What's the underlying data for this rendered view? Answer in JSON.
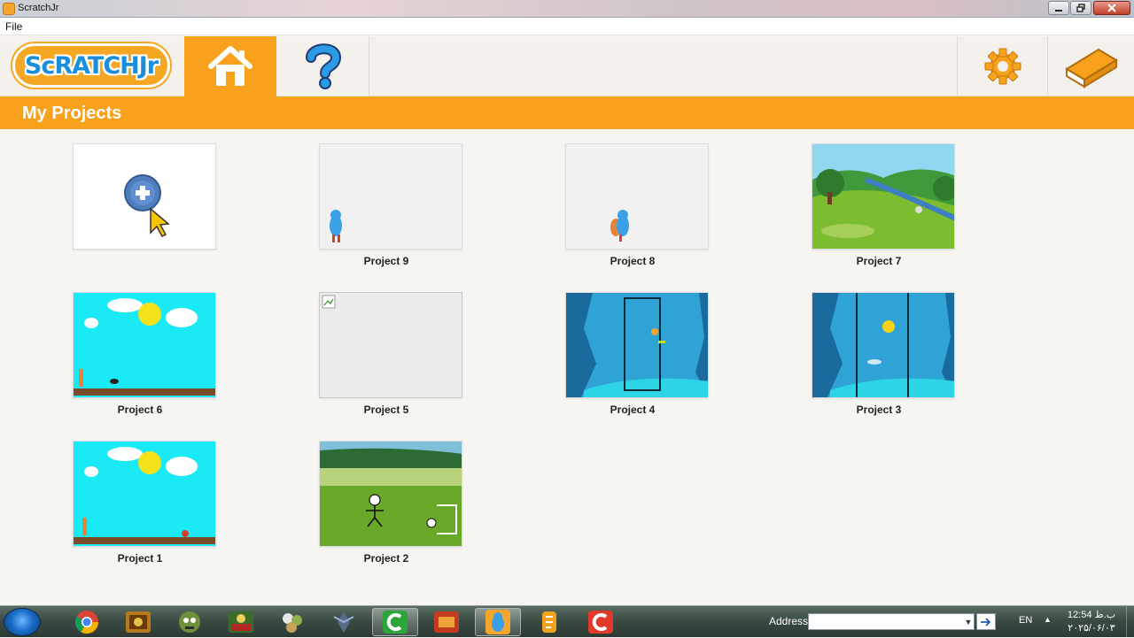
{
  "window": {
    "title": "ScratchJr"
  },
  "menubar": {
    "file": "File"
  },
  "header": {
    "logo_text": "ScRATCHJr",
    "tabs": [
      {
        "name": "home",
        "icon": "home-icon",
        "active": true
      },
      {
        "name": "help",
        "icon": "help-icon",
        "active": false
      }
    ],
    "right_buttons": [
      {
        "name": "settings",
        "icon": "gear-icon"
      },
      {
        "name": "book",
        "icon": "book-icon"
      }
    ],
    "accent_color": "#f7a11d"
  },
  "section": {
    "title": "My Projects"
  },
  "projects": [
    {
      "label": "",
      "thumb": "new",
      "icon": "plus-icon"
    },
    {
      "label": "Project 9",
      "thumb": "blank-character"
    },
    {
      "label": "Project 8",
      "thumb": "blank-character"
    },
    {
      "label": "Project 7",
      "thumb": "meadow-river"
    },
    {
      "label": "Project 6",
      "thumb": "sky-sun"
    },
    {
      "label": "Project 5",
      "thumb": "broken-image"
    },
    {
      "label": "Project 4",
      "thumb": "underwater"
    },
    {
      "label": "Project 3",
      "thumb": "underwater"
    },
    {
      "label": "Project 1",
      "thumb": "sky-sun"
    },
    {
      "label": "Project 2",
      "thumb": "soccer-field"
    }
  ],
  "taskbar": {
    "start_icon": "windows-start-icon",
    "apps": [
      {
        "name": "chrome",
        "icon": "chrome-icon",
        "active": false
      },
      {
        "name": "game-1",
        "icon": "game-icon",
        "active": false
      },
      {
        "name": "game-2",
        "icon": "zombie-icon",
        "active": false
      },
      {
        "name": "game-3",
        "icon": "game-icon",
        "active": false
      },
      {
        "name": "game-4",
        "icon": "game-icon",
        "active": false
      },
      {
        "name": "game-5",
        "icon": "game-icon",
        "active": false
      },
      {
        "name": "camtasia",
        "icon": "camtasia-icon",
        "active": true
      },
      {
        "name": "game-6",
        "icon": "game-icon",
        "active": false
      },
      {
        "name": "scratchjr",
        "icon": "scratchjr-icon",
        "active": true
      },
      {
        "name": "app-8",
        "icon": "app-icon",
        "active": false
      },
      {
        "name": "recorder",
        "icon": "recorder-icon",
        "active": false
      }
    ],
    "address_label": "Address",
    "address_value": "",
    "language": "EN",
    "clock_time": "12:54 ب.ظ",
    "clock_date": "۲۰۲۵/۰۶/۰۳"
  }
}
